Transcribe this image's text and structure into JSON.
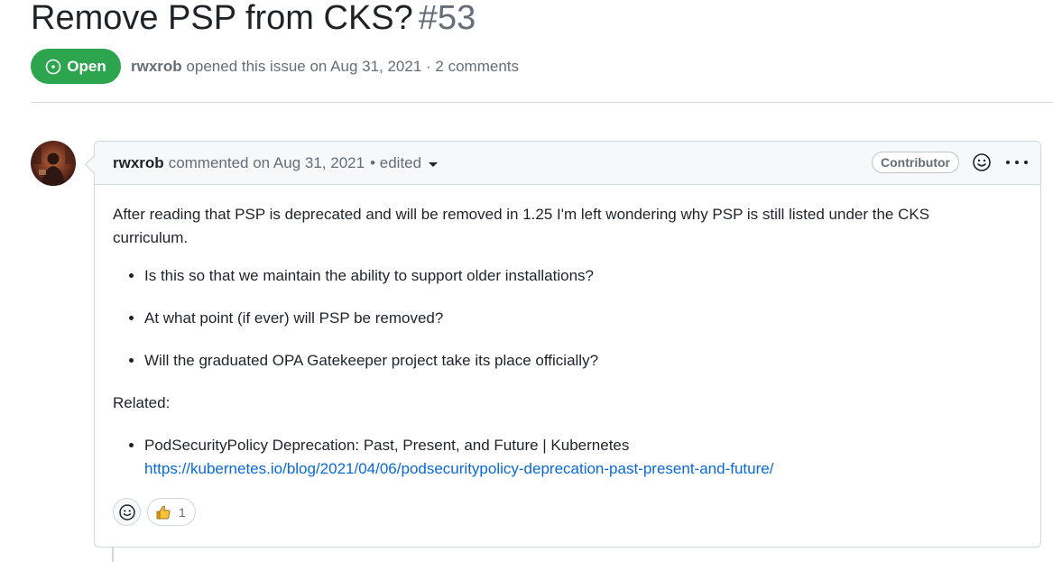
{
  "issue": {
    "title": "Remove PSP from CKS?",
    "number": "#53",
    "state": "Open",
    "author": "rwxrob",
    "opened_text": "opened this issue on Aug 31, 2021 · 2 comments"
  },
  "comment": {
    "author": "rwxrob",
    "commented_text": "commented on Aug 31, 2021",
    "edited_text": "• edited",
    "role_badge": "Contributor",
    "body": {
      "intro": "After reading that PSP is deprecated and will be removed in 1.25 I'm left wondering why PSP is still listed under the CKS curriculum.",
      "questions": [
        "Is this so that we maintain the ability to support older installations?",
        "At what point (if ever) will PSP be removed?",
        "Will the graduated OPA Gatekeeper project take its place officially?"
      ],
      "related_label": "Related:",
      "related_title": "PodSecurityPolicy Deprecation: Past, Present, and Future | Kubernetes",
      "related_url": "https://kubernetes.io/blog/2021/04/06/podsecuritypolicy-deprecation-past-present-and-future/"
    },
    "reactions": {
      "thumbs_up_count": "1"
    }
  },
  "icons": {
    "state": "issue-open-icon",
    "caret": "caret-down-icon",
    "emoji": "smiley-icon",
    "menu": "kebab-horizontal-icon",
    "thumbs_up": "thumbs-up-icon"
  },
  "colors": {
    "open_green": "#2da44e",
    "link_blue": "#0969da",
    "muted_text": "#656d76",
    "border": "#d0d7de",
    "header_bg": "#f6f8fa"
  }
}
